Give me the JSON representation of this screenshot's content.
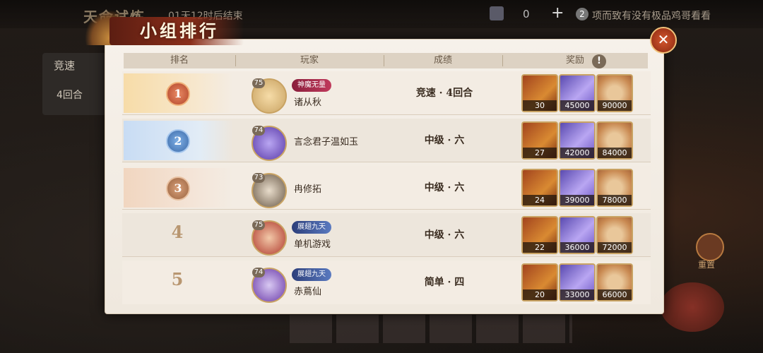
{
  "background": {
    "title": "天命试炼",
    "timer": "01天12时后结束",
    "coin_count": "0",
    "plus_icon": "+",
    "tip_number": "2",
    "tip_text": "项而致有没有极品鸡哥看看",
    "side_label": "竞速",
    "side_rounds": "4回合",
    "right_label": "重置"
  },
  "dialog": {
    "title": "小组排行",
    "close_icon": "✕",
    "info_icon": "!",
    "headers": {
      "rank": "排名",
      "player": "玩家",
      "score": "成绩",
      "reward": "奖励"
    }
  },
  "rows": [
    {
      "rank": "1",
      "level": "75",
      "player": "诸从秋",
      "title": "神魔无量",
      "title_style": "red",
      "score": "竞速 · 4回合",
      "rewards": [
        "30",
        "45000",
        "90000"
      ]
    },
    {
      "rank": "2",
      "level": "74",
      "player": "言念君子温如玉",
      "title": "",
      "title_style": "",
      "score": "中级 · 六",
      "rewards": [
        "27",
        "42000",
        "84000"
      ]
    },
    {
      "rank": "3",
      "level": "73",
      "player": "冉修拓",
      "title": "",
      "title_style": "",
      "score": "中级 · 六",
      "rewards": [
        "24",
        "39000",
        "78000"
      ]
    },
    {
      "rank": "4",
      "level": "75",
      "player": "单机游戏",
      "title": "展翅九天",
      "title_style": "blue",
      "score": "中级 · 六",
      "rewards": [
        "22",
        "36000",
        "72000"
      ]
    },
    {
      "rank": "5",
      "level": "74",
      "player": "赤蔦仙",
      "title": "展翅九天",
      "title_style": "blue",
      "score": "简单 · 四",
      "rewards": [
        "20",
        "33000",
        "66000"
      ]
    }
  ],
  "colors": {
    "gold_medal": "#c9583a",
    "silver_medal": "#4f84c8",
    "bronze_medal": "#b07a52"
  }
}
